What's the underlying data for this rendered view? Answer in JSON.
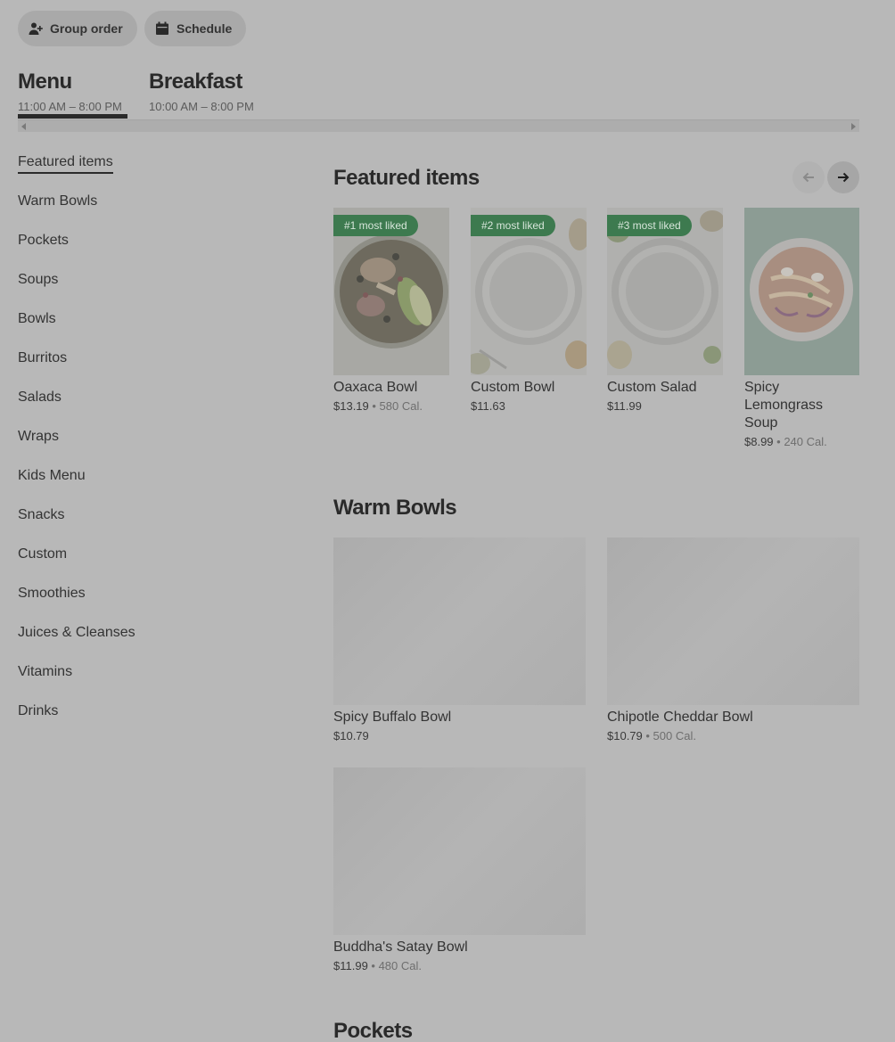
{
  "top_actions": {
    "group_order": "Group order",
    "schedule": "Schedule"
  },
  "menus": [
    {
      "title": "Menu",
      "hours": "11:00 AM – 8:00 PM"
    },
    {
      "title": "Breakfast",
      "hours": "10:00 AM – 8:00 PM"
    }
  ],
  "sidebar": {
    "items": [
      "Featured items",
      "Warm Bowls",
      "Pockets",
      "Soups",
      "Bowls",
      "Burritos",
      "Salads",
      "Wraps",
      "Kids Menu",
      "Snacks",
      "Custom",
      "Smoothies",
      "Juices & Cleanses",
      "Vitamins",
      "Drinks"
    ],
    "active": "Featured items"
  },
  "featured": {
    "title": "Featured items",
    "items": [
      {
        "badge": "#1 most liked",
        "name": "Oaxaca Bowl",
        "price": "$13.19",
        "sep": " • ",
        "cal": "580 Cal."
      },
      {
        "badge": "#2 most liked",
        "name": "Custom Bowl",
        "price": "$11.63"
      },
      {
        "badge": "#3 most liked",
        "name": "Custom Salad",
        "price": "$11.99"
      },
      {
        "name": "Spicy Lemongrass Soup",
        "price": "$8.99",
        "sep": " • ",
        "cal": "240 Cal."
      }
    ]
  },
  "warm_bowls": {
    "title": "Warm Bowls",
    "items": [
      {
        "name": "Spicy Buffalo Bowl",
        "price": "$10.79"
      },
      {
        "name": "Chipotle Cheddar Bowl",
        "price": "$10.79",
        "sep": " • ",
        "cal": "500 Cal."
      },
      {
        "name": "Buddha's Satay Bowl",
        "price": "$11.99",
        "sep": " • ",
        "cal": "480 Cal."
      }
    ]
  },
  "pockets": {
    "title": "Pockets"
  },
  "colors": {
    "badge_green": "#3d7a4f",
    "overlay_gray": "#b8b8b8"
  }
}
